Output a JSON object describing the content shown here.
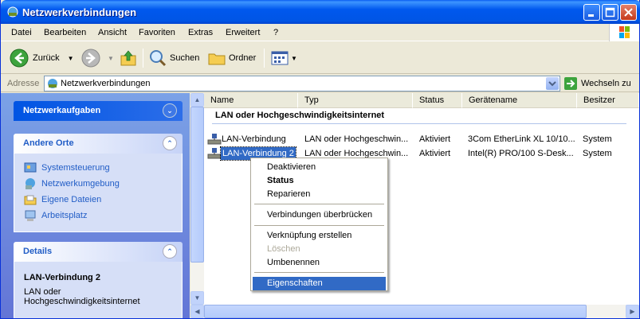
{
  "window": {
    "title": "Netzwerkverbindungen"
  },
  "menu": [
    "Datei",
    "Bearbeiten",
    "Ansicht",
    "Favoriten",
    "Extras",
    "Erweitert",
    "?"
  ],
  "toolbar": {
    "back": "Zurück",
    "search": "Suchen",
    "folders": "Ordner"
  },
  "address": {
    "label": "Adresse",
    "value": "Netzwerkverbindungen",
    "go": "Wechseln zu"
  },
  "tasks": {
    "network_title": "Netzwerkaufgaben",
    "other_title": "Andere Orte",
    "other_places": [
      "Systemsteuerung",
      "Netzwerkumgebung",
      "Eigene Dateien",
      "Arbeitsplatz"
    ],
    "details_title": "Details",
    "details_name": "LAN-Verbindung 2",
    "details_type_1": "LAN oder",
    "details_type_2": "Hochgeschwindigkeitsinternet"
  },
  "columns": [
    "Name",
    "Typ",
    "Status",
    "Gerätename",
    "Besitzer"
  ],
  "group_title": "LAN oder Hochgeschwindigkeitsinternet",
  "rows": [
    {
      "name": "LAN-Verbindung",
      "type": "LAN oder Hochgeschwin...",
      "status": "Aktiviert",
      "device": "3Com EtherLink XL 10/10...",
      "owner": "System"
    },
    {
      "name": "LAN-Verbindung 2",
      "type": "LAN oder Hochgeschwin...",
      "status": "Aktiviert",
      "device": "Intel(R) PRO/100 S-Desk...",
      "owner": "System"
    }
  ],
  "context_menu": {
    "deactivate": "Deaktivieren",
    "status": "Status",
    "repair": "Reparieren",
    "bridge": "Verbindungen überbrücken",
    "shortcut": "Verknüpfung erstellen",
    "delete": "Löschen",
    "rename": "Umbenennen",
    "properties": "Eigenschaften"
  },
  "colors": {
    "selection": "#316AC5",
    "title_blue": "#0055E5",
    "link_blue": "#215DC6"
  }
}
